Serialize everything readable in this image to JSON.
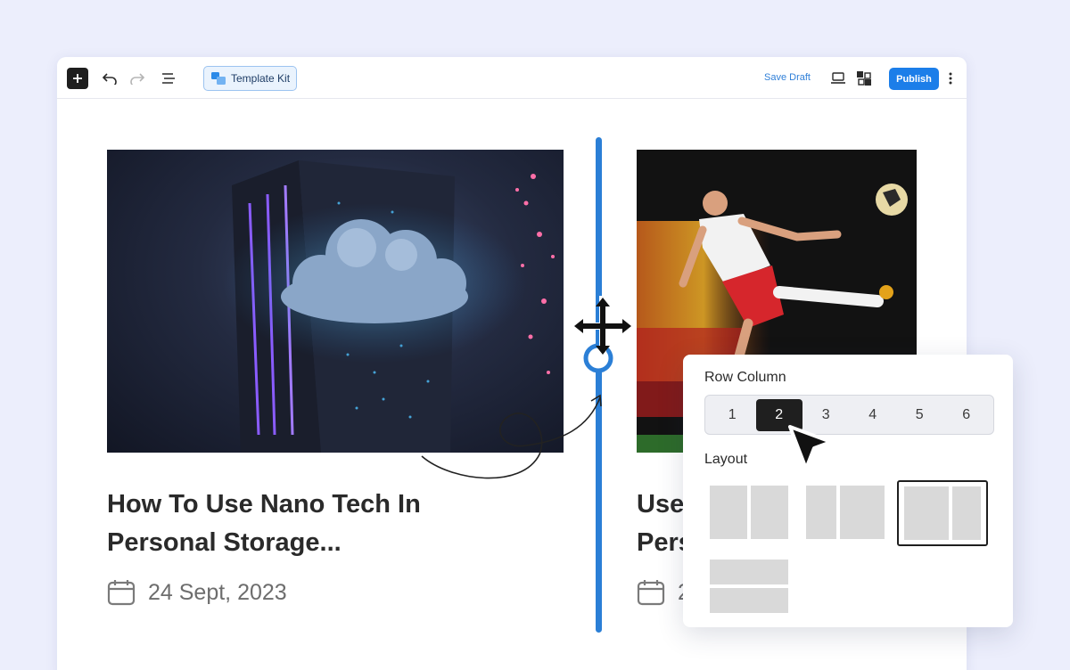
{
  "toolbar": {
    "template_kit_label": "Template Kit",
    "save_draft_label": "Save Draft",
    "publish_label": "Publish"
  },
  "cards": [
    {
      "title": "How To Use Nano Tech In Personal Storage...",
      "date": "24 Sept, 2023"
    },
    {
      "title": "Use",
      "date": "2"
    }
  ],
  "panel": {
    "row_column_label": "Row Column",
    "columns": [
      "1",
      "2",
      "3",
      "4",
      "5",
      "6"
    ],
    "selected_column": "2",
    "layout_label": "Layout"
  },
  "colors": {
    "accent": "#1c7ee9",
    "divider": "#2b7fd6",
    "selected": "#1f1f1f"
  }
}
